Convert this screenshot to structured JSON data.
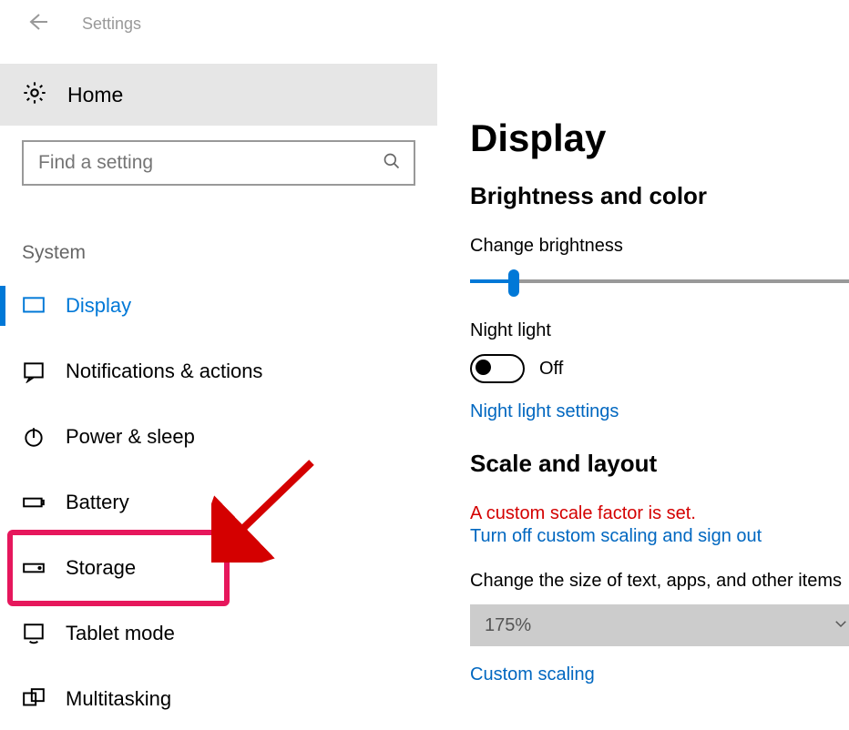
{
  "header": {
    "title": "Settings"
  },
  "sidebar": {
    "home": "Home",
    "search_placeholder": "Find a setting",
    "section": "System",
    "items": [
      {
        "label": "Display",
        "active": true
      },
      {
        "label": "Notifications & actions"
      },
      {
        "label": "Power & sleep"
      },
      {
        "label": "Battery"
      },
      {
        "label": "Storage",
        "highlighted": true
      },
      {
        "label": "Tablet mode"
      },
      {
        "label": "Multitasking"
      }
    ]
  },
  "main": {
    "title": "Display",
    "brightness_section": "Brightness and color",
    "change_brightness": "Change brightness",
    "night_light": "Night light",
    "night_light_state": "Off",
    "night_light_settings": "Night light settings",
    "scale_section": "Scale and layout",
    "custom_scale_warning": "A custom scale factor is set.",
    "turn_off_scaling": "Turn off custom scaling and sign out",
    "change_size": "Change the size of text, apps, and other items",
    "scale_value": "175%",
    "custom_scaling": "Custom scaling"
  }
}
